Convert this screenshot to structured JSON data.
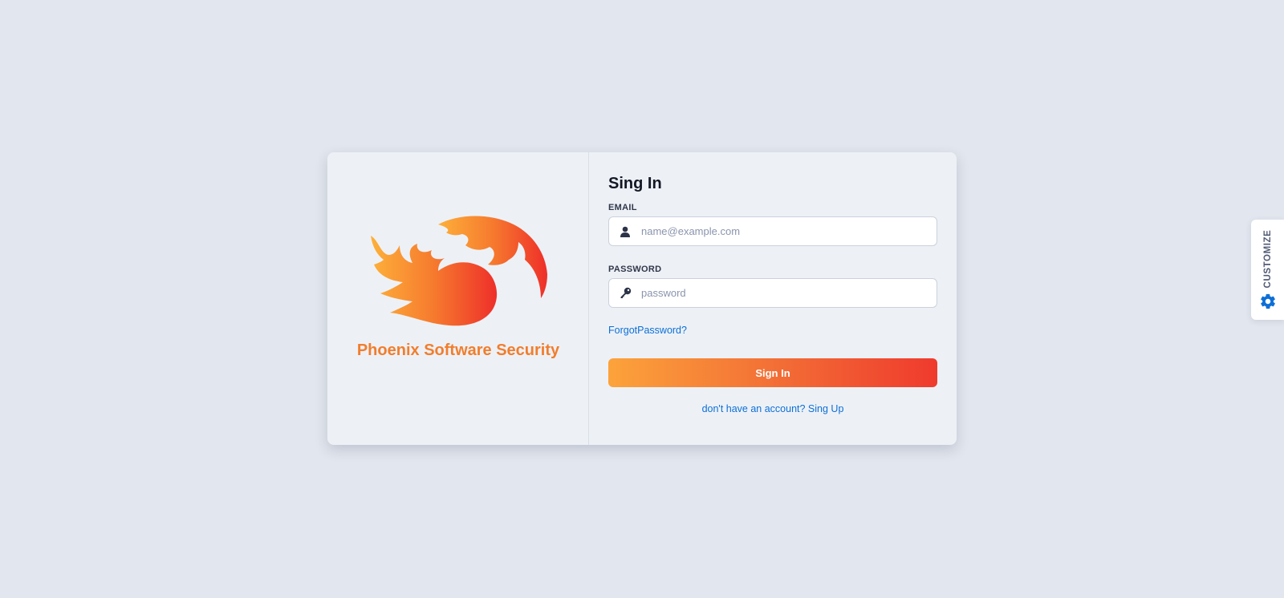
{
  "brand": {
    "name": "Phoenix Software Security"
  },
  "form": {
    "title": "Sing In",
    "email_label": "EMAIL",
    "email_placeholder": "name@example.com",
    "email_value": "",
    "password_label": "PASSWORD",
    "password_placeholder": "password",
    "password_value": "",
    "forgot_link": "ForgotPassword?",
    "submit_label": "Sign In",
    "signup_link": "don't have an account? Sing Up"
  },
  "customize": {
    "label": "CUSTOMIZE",
    "icon": "gear-icon"
  },
  "icons": {
    "email": "user-icon",
    "password": "key-icon",
    "logo": "phoenix-logo"
  },
  "colors": {
    "background": "#e2e6ee",
    "card": "#edf1f6",
    "brand_orange": "#f27d2c",
    "gradient_start": "#fca33b",
    "gradient_end": "#ef3a2d",
    "link": "#0d6fd6",
    "title": "#141824"
  }
}
